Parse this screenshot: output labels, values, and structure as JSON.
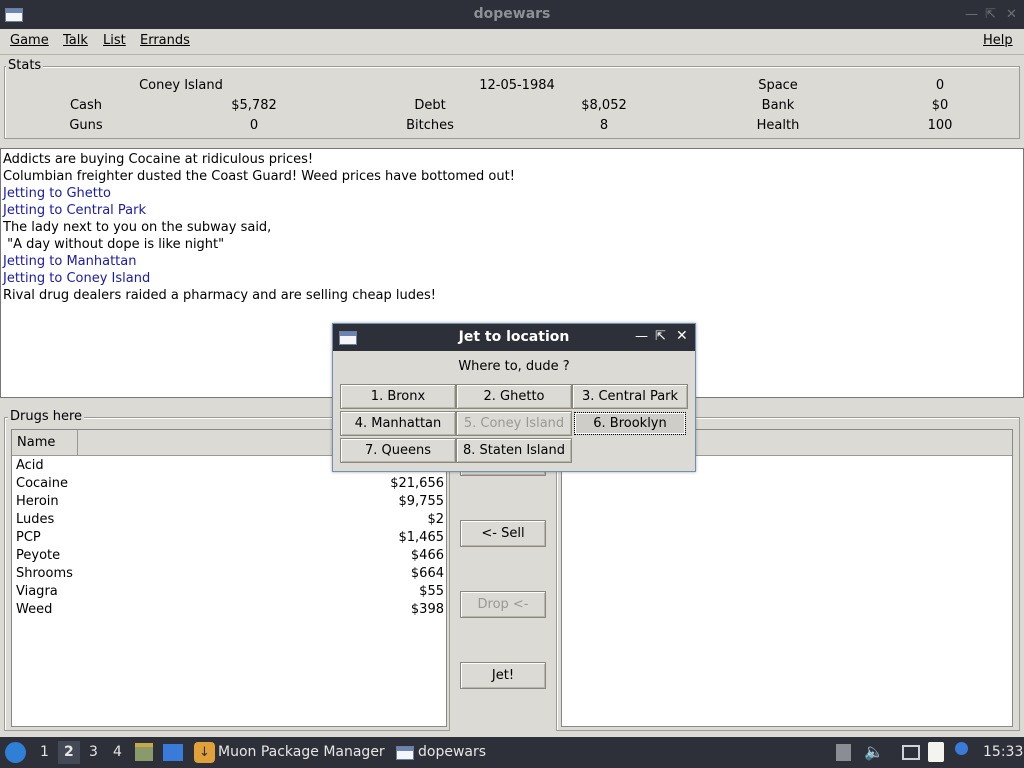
{
  "window": {
    "title": "dopewars"
  },
  "menu": {
    "game": "Game",
    "talk": "Talk",
    "list": "List",
    "errands": "Errands",
    "help": "Help"
  },
  "stats": {
    "label": "Stats",
    "location": "Coney Island",
    "date": "12-05-1984",
    "space_label": "Space",
    "space_value": "0",
    "cash_label": "Cash",
    "cash_value": "$5,782",
    "debt_label": "Debt",
    "debt_value": "$8,052",
    "bank_label": "Bank",
    "bank_value": "$0",
    "guns_label": "Guns",
    "guns_value": "0",
    "bitches_label": "Bitches",
    "bitches_value": "8",
    "health_label": "Health",
    "health_value": "100"
  },
  "log": [
    {
      "text": "Addicts are buying Cocaine at ridiculous prices!",
      "color": "#000000"
    },
    {
      "text": "Columbian freighter dusted the Coast Guard! Weed prices have bottomed out!",
      "color": "#000000"
    },
    {
      "text": "Jetting to Ghetto",
      "color": "#1a1aa6"
    },
    {
      "text": "Jetting to Central Park",
      "color": "#1a1aa6"
    },
    {
      "text": "The lady next to you on the subway said,",
      "color": "#000000"
    },
    {
      "text": " \"A day without dope is like night\"",
      "color": "#000000"
    },
    {
      "text": "Jetting to Manhattan",
      "color": "#1a1aa6"
    },
    {
      "text": "Jetting to Coney Island",
      "color": "#1a1aa6"
    },
    {
      "text": "Rival drug dealers raided a pharmacy and are selling cheap ludes!",
      "color": "#000000"
    }
  ],
  "drugs": {
    "label": "Drugs here",
    "column_name": "Name",
    "items": [
      {
        "name": "Acid",
        "price": ""
      },
      {
        "name": "Cocaine",
        "price": "$21,656"
      },
      {
        "name": "Heroin",
        "price": "$9,755"
      },
      {
        "name": "Ludes",
        "price": "$2"
      },
      {
        "name": "PCP",
        "price": "$1,465"
      },
      {
        "name": "Peyote",
        "price": "$466"
      },
      {
        "name": "Shrooms",
        "price": "$664"
      },
      {
        "name": "Viagra",
        "price": "$55"
      },
      {
        "name": "Weed",
        "price": "$398"
      }
    ]
  },
  "actions": {
    "sell": "<- Sell",
    "drop": "Drop <-",
    "jet": "Jet!"
  },
  "dialog": {
    "title": "Jet to location",
    "prompt": "Where to, dude ?",
    "locations": [
      "1. Bronx",
      "2. Ghetto",
      "3. Central Park",
      "4. Manhattan",
      "5. Coney Island",
      "6. Brooklyn",
      "7. Queens",
      "8. Staten Island"
    ]
  },
  "taskbar": {
    "workspaces": [
      "1",
      "2",
      "3",
      "4"
    ],
    "task1": "Muon Package Manager",
    "task2": "dopewars",
    "clock": "15:33"
  },
  "colors": {
    "titlebar": "#2d3038",
    "window_bg": "#dcdad5",
    "log_blue": "#1a1aa6"
  }
}
